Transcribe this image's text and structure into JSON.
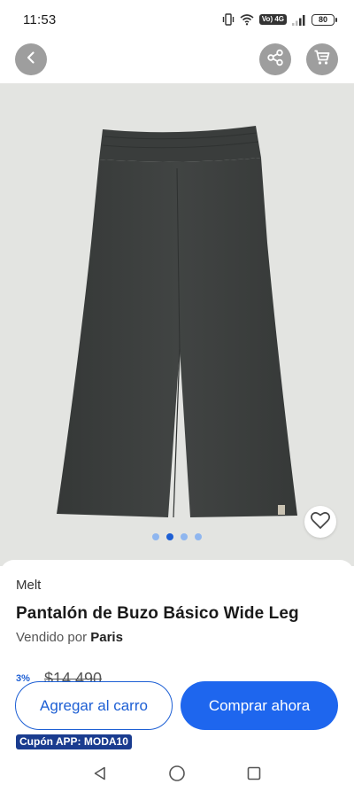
{
  "status_bar": {
    "time": "11:53",
    "network_label": "Vo) 4G",
    "battery_level": "80",
    "icons": [
      "vibrate-icon",
      "wifi-icon",
      "signal-icon",
      "battery-icon"
    ]
  },
  "header": {
    "icons": [
      "back-arrow-icon",
      "share-icon",
      "cart-icon"
    ]
  },
  "gallery": {
    "image_subject": "dark grey wide leg sweatpants",
    "dot_count": 4,
    "active_dot": 1,
    "favorite_icon": "heart-outline-icon"
  },
  "product": {
    "brand": "Melt",
    "title": "Pantalón de Buzo Básico Wide Leg",
    "seller_prefix": "Vendido por",
    "seller_name": "Paris",
    "discount": "3%",
    "old_price": "$14.490"
  },
  "actions": {
    "add_to_cart_label": "Agregar al carro",
    "buy_now_label": "Comprar ahora"
  },
  "coupon": {
    "label": "Cupón APP: MODA10"
  },
  "nav": {
    "icons": [
      "nav-back-icon",
      "nav-home-icon",
      "nav-recents-icon"
    ]
  },
  "colors": {
    "primary_blue": "#1e66ee",
    "coupon_navy": "#1a3c8f",
    "image_bg": "#e3e4e1",
    "pants": "#3b3e3d"
  }
}
